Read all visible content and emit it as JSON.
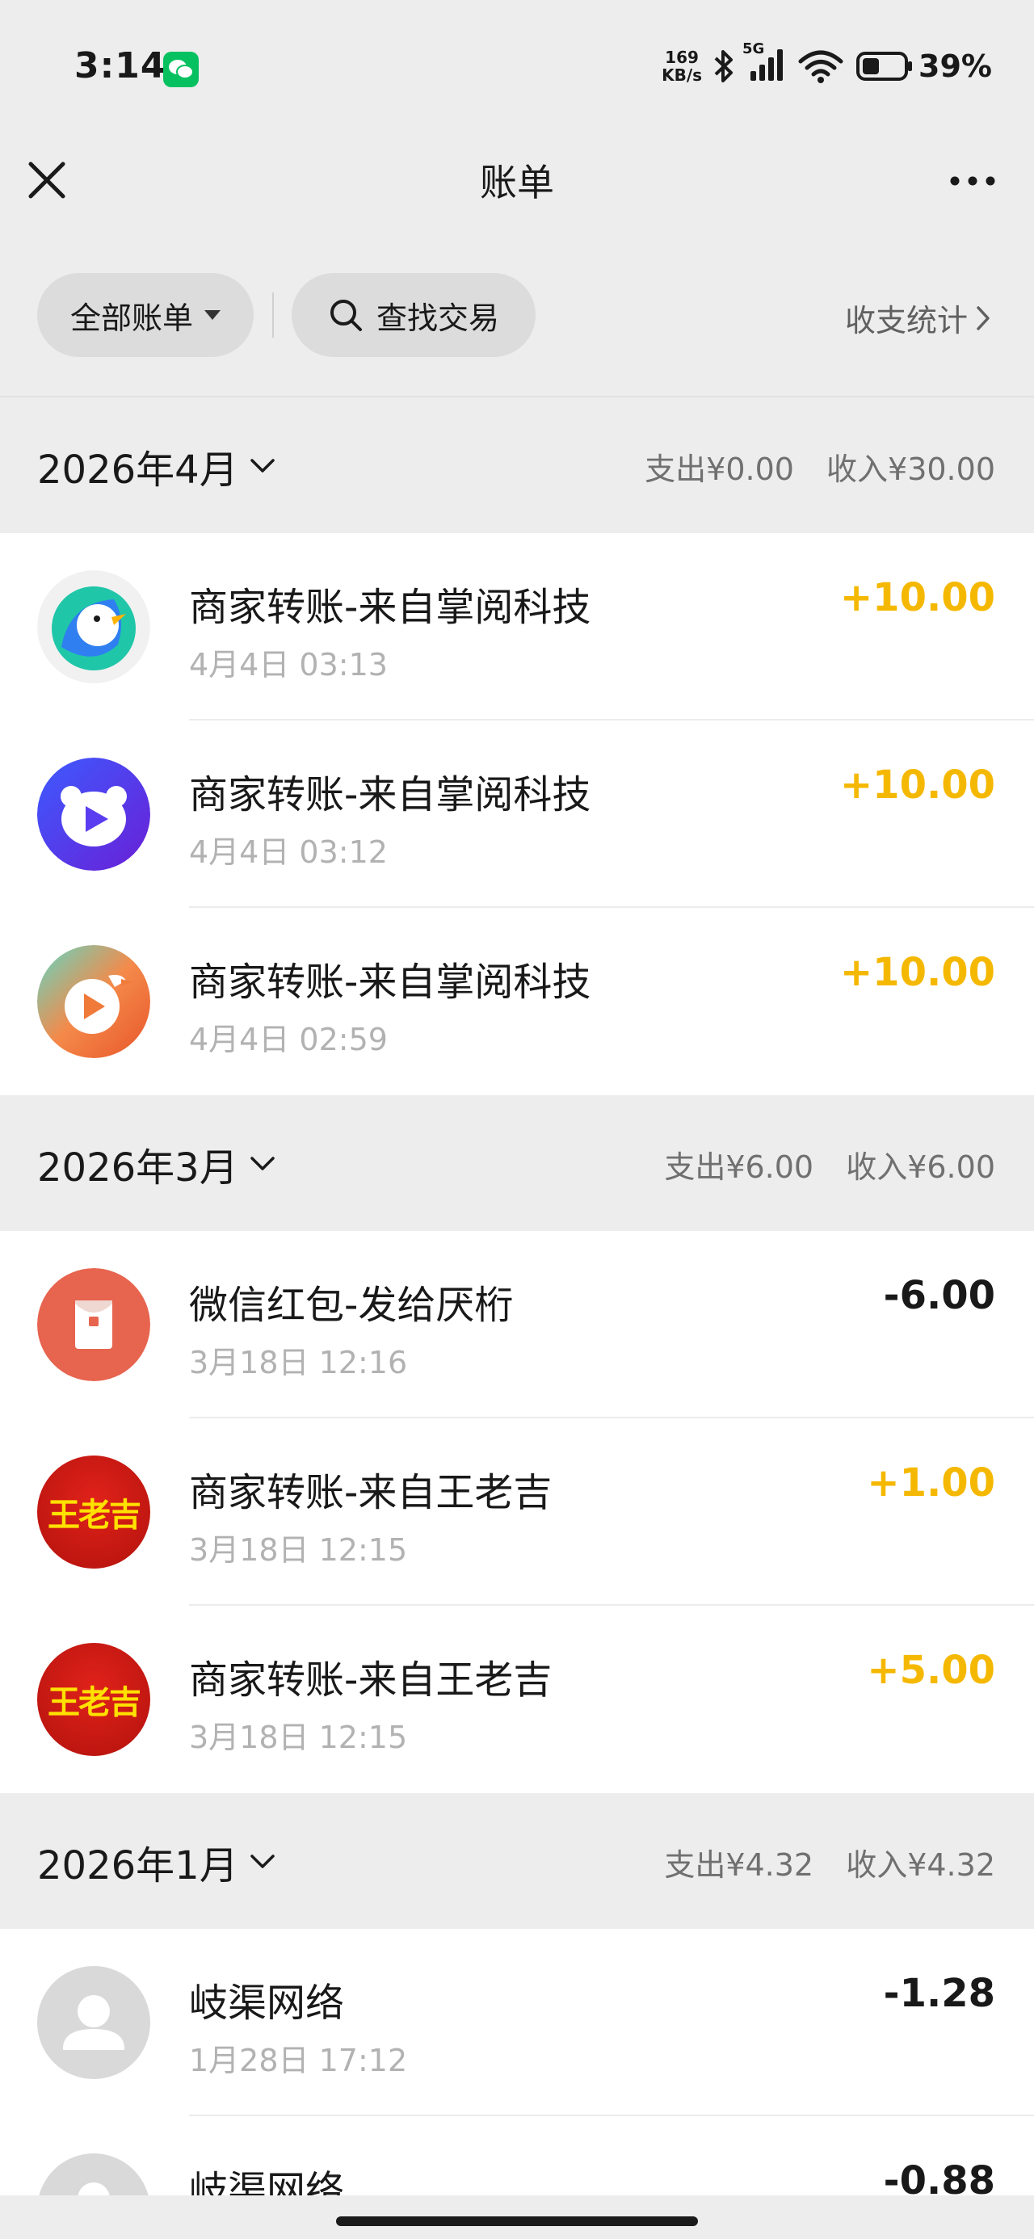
{
  "status_bar": {
    "time": "3:14",
    "net_speed_value": "169",
    "net_speed_unit": "KB/s",
    "network_type": "5G",
    "battery": "39%"
  },
  "header": {
    "title": "账单"
  },
  "filters": {
    "all_bills": "全部账单",
    "search": "查找交易",
    "stats": "收支统计"
  },
  "months": [
    {
      "title": "2026年4月",
      "expense": "支出¥0.00",
      "income": "收入¥30.00",
      "transactions": [
        {
          "title": "商家转账-来自掌阅科技",
          "time": "4月4日 03:13",
          "amount": "+10.00",
          "avatar_icon": "goose-app-icon"
        },
        {
          "title": "商家转账-来自掌阅科技",
          "time": "4月4日 03:12",
          "amount": "+10.00",
          "avatar_icon": "bear-play-app-icon"
        },
        {
          "title": "商家转账-来自掌阅科技",
          "time": "4月4日 02:59",
          "amount": "+10.00",
          "avatar_icon": "goose-play-app-icon"
        }
      ]
    },
    {
      "title": "2026年3月",
      "expense": "支出¥6.00",
      "income": "收入¥6.00",
      "transactions": [
        {
          "title": "微信红包-发给厌桁",
          "time": "3月18日 12:16",
          "amount": "-6.00",
          "avatar_icon": "red-packet-icon"
        },
        {
          "title": "商家转账-来自王老吉",
          "time": "3月18日 12:15",
          "amount": "+1.00",
          "avatar_text": "王老吉"
        },
        {
          "title": "商家转账-来自王老吉",
          "time": "3月18日 12:15",
          "amount": "+5.00",
          "avatar_text": "王老吉"
        }
      ]
    },
    {
      "title": "2026年1月",
      "expense": "支出¥4.32",
      "income": "收入¥4.32",
      "transactions": [
        {
          "title": "岐渠网络",
          "time": "1月28日 17:12",
          "amount": "-1.28",
          "avatar_icon": "default-user-icon"
        },
        {
          "title": "岐渠网络",
          "time": "",
          "amount": "-0.88",
          "avatar_icon": "default-user-icon"
        }
      ]
    }
  ],
  "colors": {
    "income": "#f5b800",
    "expense": "#191919",
    "background": "#ededed",
    "wechat_green": "#07c160"
  }
}
